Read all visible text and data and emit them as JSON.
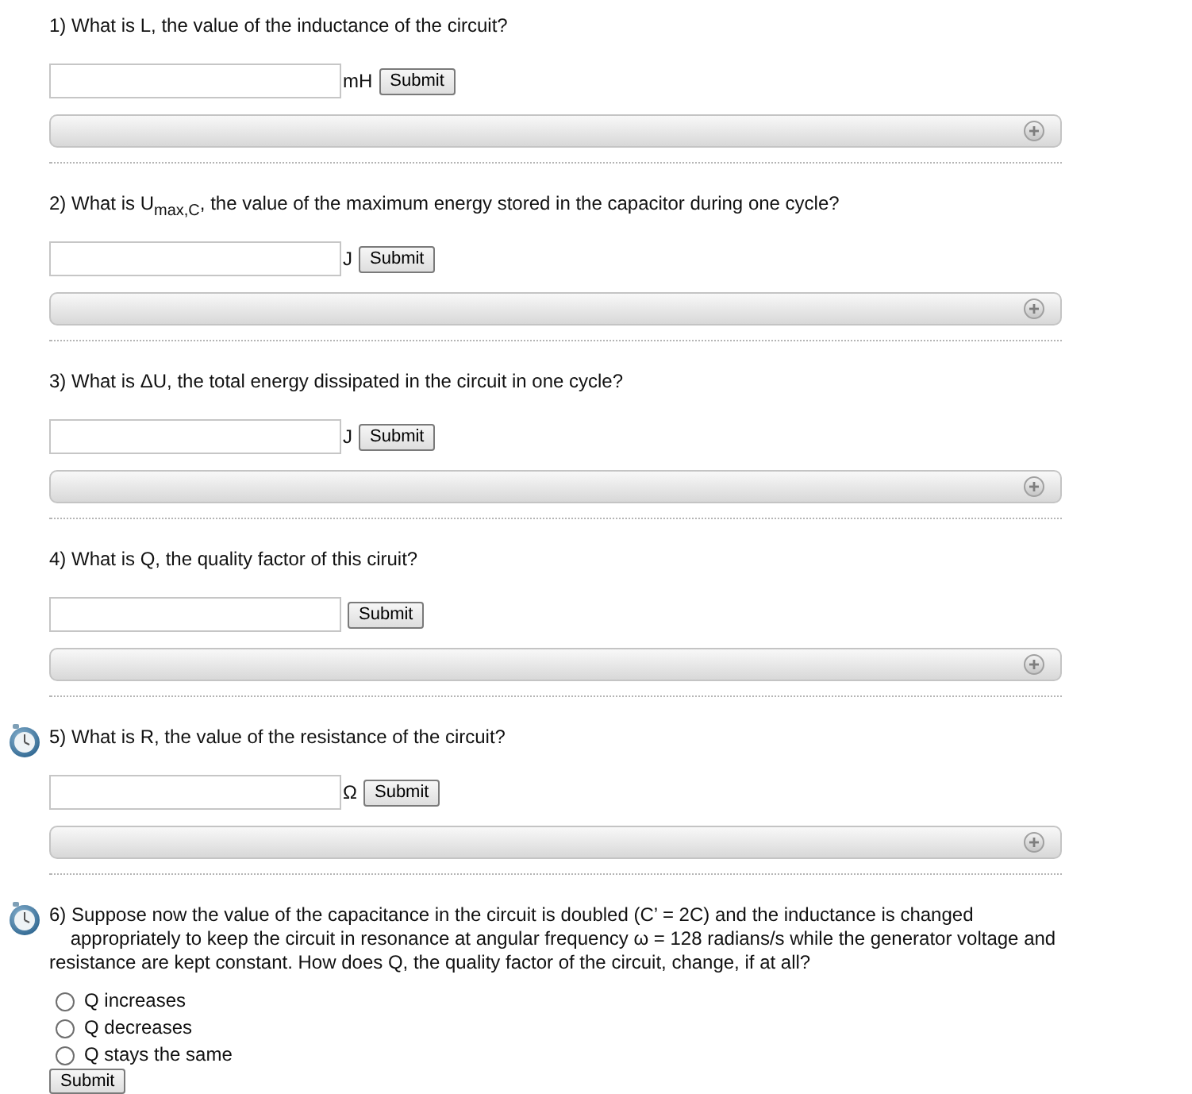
{
  "questions": [
    {
      "kind": "numeric",
      "timed": false,
      "text": "1) What is L, the value of the inductance of the circuit?",
      "unit": "mH",
      "button": "Submit",
      "hint_bar": {
        "expanded": false
      }
    },
    {
      "kind": "numeric",
      "timed": false,
      "text": "2) What is U$_{max,C}$, the value of the maximum energy stored in the capacitor during one cycle?",
      "unit": "J",
      "button": "Submit",
      "hint_bar": {
        "expanded": false
      }
    },
    {
      "kind": "numeric",
      "timed": false,
      "text": "3) What is ΔU, the total energy dissipated in the circuit in one cycle?",
      "unit": "J",
      "button": "Submit",
      "hint_bar": {
        "expanded": false
      }
    },
    {
      "kind": "numeric",
      "timed": false,
      "text": "4) What is Q, the quality factor of this ciruit?",
      "button": "Submit",
      "hint_bar": {
        "expanded": false
      }
    },
    {
      "kind": "numeric",
      "timed": true,
      "text": "5) What is R, the value of the resistance of the circuit?",
      "unit": "Ω",
      "button": "Submit",
      "hint_bar": {
        "expanded": false
      }
    },
    {
      "kind": "choice",
      "timed": true,
      "text": "6) Suppose now the value of the capacitance in the circuit is doubled (C’ = 2C) and the inductance is changed\n    appropriately to keep the circuit in resonance at angular frequency ω = 128 radians/s while the generator voltage and\nresistance are kept constant. How does Q, the quality factor of the circuit, change, if at all?",
      "options": [
        {
          "label": "Q increases",
          "selected": false
        },
        {
          "label": "Q decreases",
          "selected": false
        },
        {
          "label": "Q stays the same",
          "selected": false
        }
      ],
      "button": "Submit"
    }
  ]
}
